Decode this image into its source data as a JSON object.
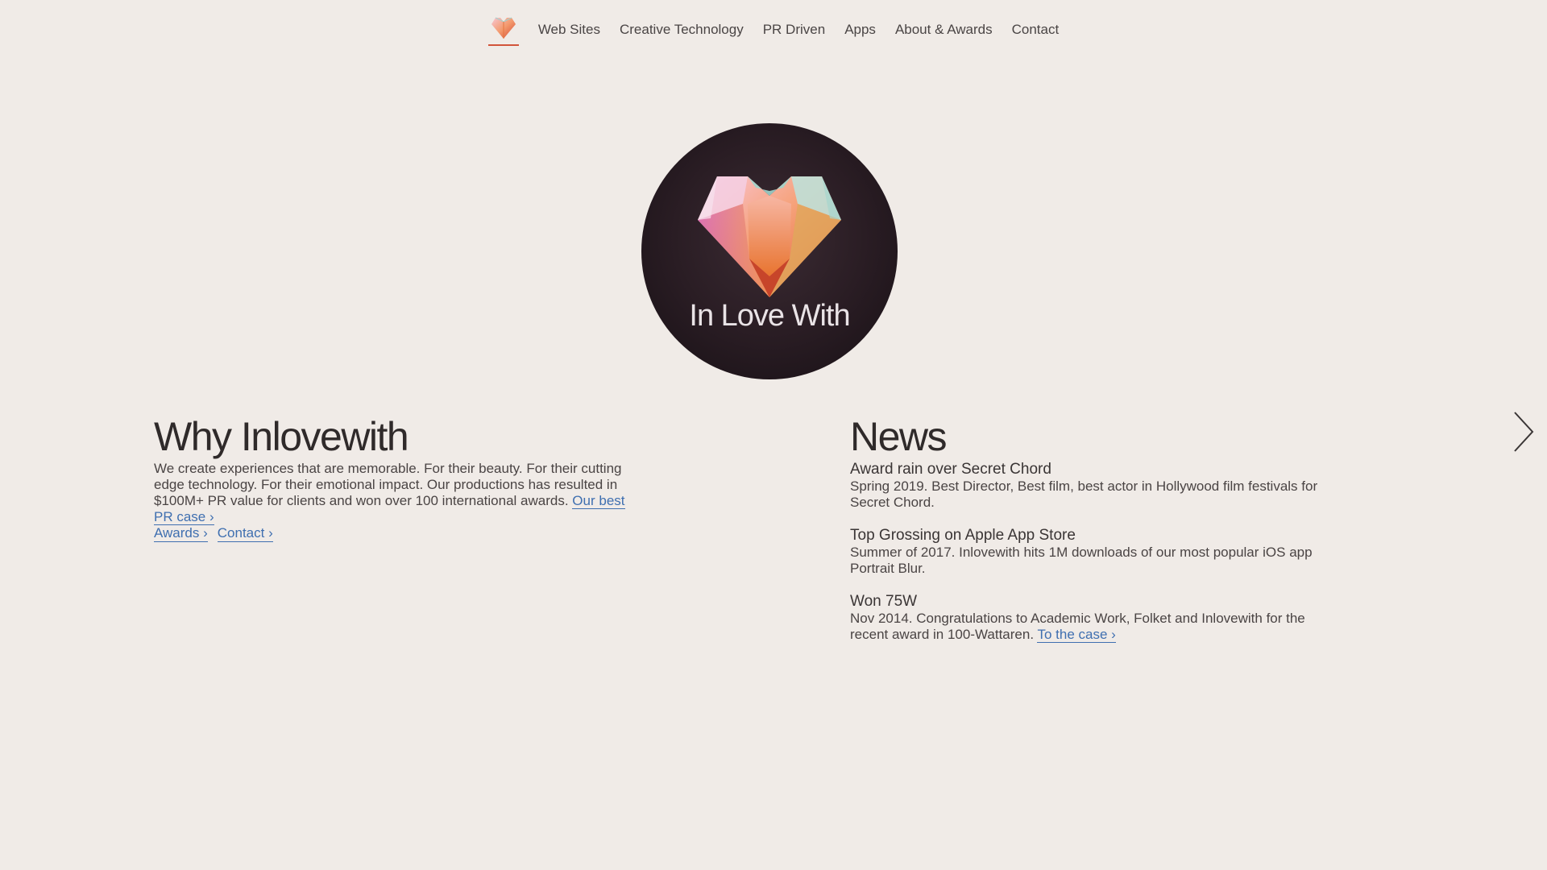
{
  "nav": {
    "logo_icon": "heart-logo-icon",
    "items": [
      {
        "label": "Web Sites"
      },
      {
        "label": "Creative Technology"
      },
      {
        "label": "PR Driven"
      },
      {
        "label": "Apps"
      },
      {
        "label": "About & Awards"
      },
      {
        "label": "Contact"
      }
    ]
  },
  "hero": {
    "wordmark": "In Love With",
    "icon": "crystal-heart-icon"
  },
  "why": {
    "title": "Why Inlovewith",
    "text": "We create experiences that are memorable. For their beauty. For their cutting edge technology. For their emotional impact. Our productions has resulted in $100M+ PR value for clients and won over 100 international awards.",
    "pr_link": "Our best PR case ›",
    "awards_link": "Awards ›",
    "contact_link": "Contact ›"
  },
  "news": {
    "title": "News",
    "items": [
      {
        "title": "Award rain over Secret Chord",
        "text": "Spring 2019. Best Director, Best film, best actor in Hollywood film festivals for Secret Chord."
      },
      {
        "title": "Top Grossing on Apple App Store",
        "text": "Summer of 2017. Inlovewith hits 1M downloads of our most popular iOS app Portrait Blur."
      },
      {
        "title": "Won 75W",
        "text": "Nov 2014. Congratulations to Academic Work, Folket and Inlovewith for the recent award in 100-Wattaren.",
        "link": "To the case ›"
      }
    ]
  },
  "colors": {
    "background": "#f0ebe7",
    "link": "#3f6fb0",
    "accent": "#d2543a"
  },
  "next_arrow_icon": "chevron-right-icon"
}
